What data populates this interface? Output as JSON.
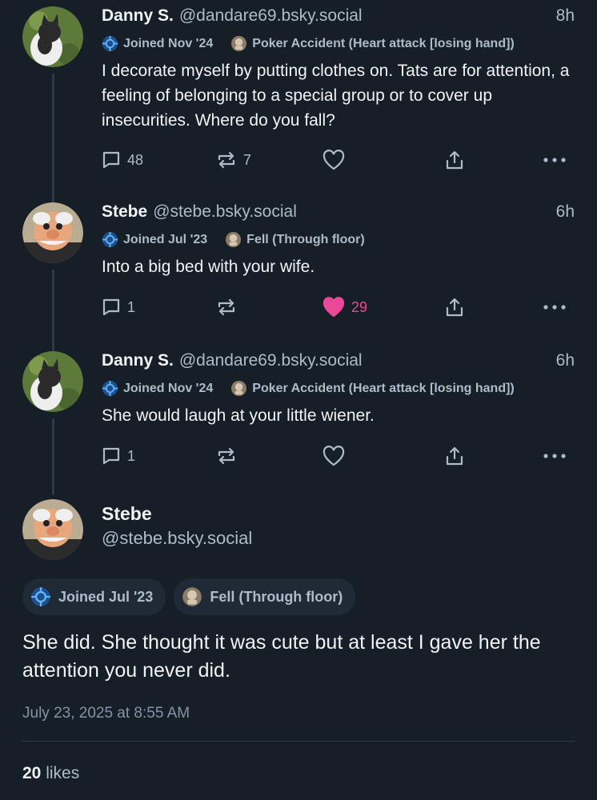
{
  "posts": [
    {
      "name": "Danny S.",
      "handle": "@dandare69.bsky.social",
      "time": "8h",
      "badge_joined": "Joined Nov '24",
      "badge_status": "Poker Accident (Heart attack [losing hand])",
      "text": "I decorate myself by putting clothes on. Tats are for attention, a feeling of belonging to a special group or to cover up insecurities. Where do you fall?",
      "replies": "48",
      "reposts": "7",
      "likes": "",
      "liked": false
    },
    {
      "name": "Stebe",
      "handle": "@stebe.bsky.social",
      "time": "6h",
      "badge_joined": "Joined Jul '23",
      "badge_status": "Fell (Through floor)",
      "text": "Into a big bed with your wife.",
      "replies": "1",
      "reposts": "",
      "likes": "29",
      "liked": true
    },
    {
      "name": "Danny S.",
      "handle": "@dandare69.bsky.social",
      "time": "6h",
      "badge_joined": "Joined Nov '24",
      "badge_status": "Poker Accident (Heart attack [losing hand])",
      "text": "She would laugh at your little wiener.",
      "replies": "1",
      "reposts": "",
      "likes": "",
      "liked": false
    }
  ],
  "main_post": {
    "name": "Stebe",
    "handle": "@stebe.bsky.social",
    "badge_joined": "Joined Jul '23",
    "badge_status": "Fell (Through floor)",
    "text": "She did. She thought it was cute but at least I gave her the attention you never did.",
    "date": "July 23, 2025 at 8:55 AM",
    "likes_count": "20",
    "likes_label": "likes"
  },
  "colors": {
    "background": "#161e27",
    "muted_text": "#aebbc9",
    "like_pink": "#ec4899"
  },
  "icons": [
    "reply-icon",
    "repost-icon",
    "like-icon",
    "share-icon",
    "more-icon",
    "joined-badge-icon",
    "status-badge-icon"
  ]
}
